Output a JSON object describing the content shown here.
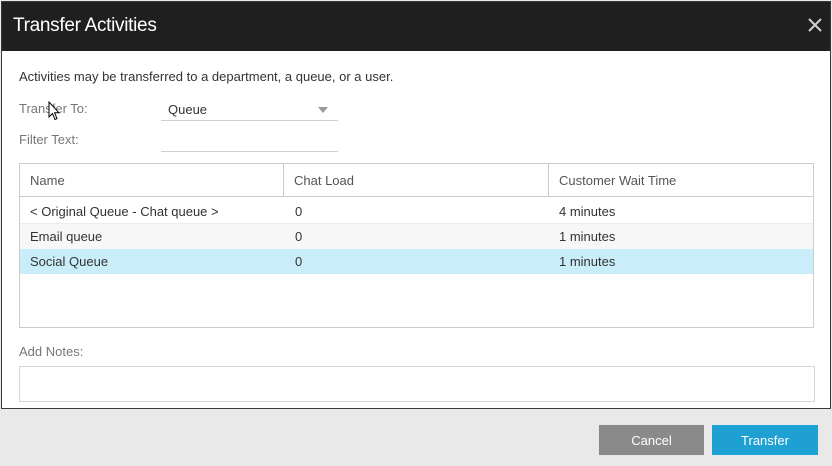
{
  "dialog": {
    "title": "Transfer Activities",
    "close_icon": "close-icon"
  },
  "intro_text": "Activities may be transferred to a department, a queue, or a user.",
  "transfer_to": {
    "label": "Transfer To:",
    "selected": "Queue"
  },
  "filter": {
    "label": "Filter Text:",
    "value": ""
  },
  "grid": {
    "columns": [
      "Name",
      "Chat Load",
      "Customer Wait Time"
    ],
    "rows": [
      {
        "name": "< Original Queue - Chat queue >",
        "chat_load": "0",
        "wait_time": "4 minutes",
        "selected": false
      },
      {
        "name": "Email queue",
        "chat_load": "0",
        "wait_time": "1 minutes",
        "selected": false
      },
      {
        "name": "Social Queue",
        "chat_load": "0",
        "wait_time": "1 minutes",
        "selected": true
      }
    ]
  },
  "notes": {
    "label": "Add Notes:",
    "value": ""
  },
  "buttons": {
    "cancel": "Cancel",
    "transfer": "Transfer"
  },
  "colors": {
    "titlebar": "#1f1f1f",
    "selected_row": "#c9eef9",
    "primary_button": "#1ea0d2",
    "secondary_button": "#8a8a8a"
  }
}
